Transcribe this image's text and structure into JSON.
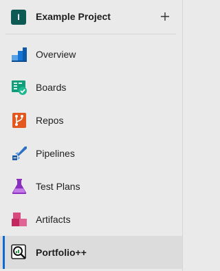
{
  "project": {
    "initial": "I",
    "name": "Example Project",
    "add_glyph": "+"
  },
  "nav_items": [
    {
      "label": "Overview",
      "icon": "overview-icon",
      "color": "#1573d4"
    },
    {
      "label": "Boards",
      "icon": "boards-icon",
      "color": "#009574"
    },
    {
      "label": "Repos",
      "icon": "repos-icon",
      "color": "#e05a2a"
    },
    {
      "label": "Pipelines",
      "icon": "pipelines-icon",
      "color": "#2d71c6"
    },
    {
      "label": "Test Plans",
      "icon": "test-plans-icon",
      "color": "#8a2fbf"
    },
    {
      "label": "Artifacts",
      "icon": "artifacts-icon",
      "color": "#c2285e"
    },
    {
      "label": "Portfolio++",
      "icon": "portfolio-icon",
      "color": "#1e1e1e",
      "selected": true
    }
  ],
  "colors": {
    "background": "#eaeaea",
    "selected_background": "#dcdcdc",
    "selected_accent": "#0b6ad1",
    "project_avatar": "#0d5a55"
  }
}
